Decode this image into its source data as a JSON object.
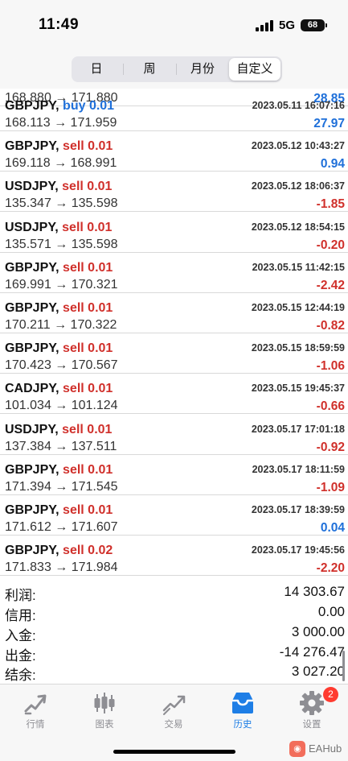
{
  "status_bar": {
    "time": "11:49",
    "network": "5G",
    "battery": "68"
  },
  "header": {
    "segments": [
      "日",
      "周",
      "月份",
      "自定义"
    ],
    "active_segment": "自定义"
  },
  "partial_row": {
    "prices": "168.880 → 171.880",
    "profit": "28.85"
  },
  "trades": [
    {
      "symbol": "GBPJPY,",
      "side": "buy 0.01",
      "side_type": "buy",
      "prices": "168.113 → 171.959",
      "time": "2023.05.11 16:07:16",
      "profit": "27.97",
      "profit_sign": "pos"
    },
    {
      "symbol": "GBPJPY,",
      "side": "sell 0.01",
      "side_type": "sell",
      "prices": "169.118 → 168.991",
      "time": "2023.05.12 10:43:27",
      "profit": "0.94",
      "profit_sign": "pos"
    },
    {
      "symbol": "USDJPY,",
      "side": "sell 0.01",
      "side_type": "sell",
      "prices": "135.347 → 135.598",
      "time": "2023.05.12 18:06:37",
      "profit": "-1.85",
      "profit_sign": "neg"
    },
    {
      "symbol": "USDJPY,",
      "side": "sell 0.01",
      "side_type": "sell",
      "prices": "135.571 → 135.598",
      "time": "2023.05.12 18:54:15",
      "profit": "-0.20",
      "profit_sign": "neg"
    },
    {
      "symbol": "GBPJPY,",
      "side": "sell 0.01",
      "side_type": "sell",
      "prices": "169.991 → 170.321",
      "time": "2023.05.15 11:42:15",
      "profit": "-2.42",
      "profit_sign": "neg"
    },
    {
      "symbol": "GBPJPY,",
      "side": "sell 0.01",
      "side_type": "sell",
      "prices": "170.211 → 170.322",
      "time": "2023.05.15 12:44:19",
      "profit": "-0.82",
      "profit_sign": "neg"
    },
    {
      "symbol": "GBPJPY,",
      "side": "sell 0.01",
      "side_type": "sell",
      "prices": "170.423 → 170.567",
      "time": "2023.05.15 18:59:59",
      "profit": "-1.06",
      "profit_sign": "neg"
    },
    {
      "symbol": "CADJPY,",
      "side": "sell 0.01",
      "side_type": "sell",
      "prices": "101.034 → 101.124",
      "time": "2023.05.15 19:45:37",
      "profit": "-0.66",
      "profit_sign": "neg"
    },
    {
      "symbol": "USDJPY,",
      "side": "sell 0.01",
      "side_type": "sell",
      "prices": "137.384 → 137.511",
      "time": "2023.05.17 17:01:18",
      "profit": "-0.92",
      "profit_sign": "neg"
    },
    {
      "symbol": "GBPJPY,",
      "side": "sell 0.01",
      "side_type": "sell",
      "prices": "171.394 → 171.545",
      "time": "2023.05.17 18:11:59",
      "profit": "-1.09",
      "profit_sign": "neg"
    },
    {
      "symbol": "GBPJPY,",
      "side": "sell 0.01",
      "side_type": "sell",
      "prices": "171.612 → 171.607",
      "time": "2023.05.17 18:39:59",
      "profit": "0.04",
      "profit_sign": "pos"
    },
    {
      "symbol": "GBPJPY,",
      "side": "sell 0.02",
      "side_type": "sell",
      "prices": "171.833 → 171.984",
      "time": "2023.05.17 19:45:56",
      "profit": "-2.20",
      "profit_sign": "neg"
    }
  ],
  "summary": [
    {
      "label": "利润:",
      "value": "14 303.67"
    },
    {
      "label": "信用:",
      "value": "0.00"
    },
    {
      "label": "入金:",
      "value": "3 000.00"
    },
    {
      "label": "出金:",
      "value": "-14 276.47"
    },
    {
      "label": "结余:",
      "value": "3 027.20"
    }
  ],
  "tabbar": {
    "tabs": [
      {
        "label": "行情",
        "icon": "quotes-icon"
      },
      {
        "label": "图表",
        "icon": "candlestick-chart-icon"
      },
      {
        "label": "交易",
        "icon": "trade-icon"
      },
      {
        "label": "历史",
        "icon": "history-inbox-icon"
      },
      {
        "label": "设置",
        "icon": "gear-icon"
      }
    ],
    "active_tab": "历史",
    "settings_badge": "2"
  },
  "watermark": {
    "text": "EAHub"
  },
  "colors": {
    "buy": "#1e6fd9",
    "sell": "#d0302b",
    "profit_positive": "#1e6fd9",
    "profit_negative": "#d0302b",
    "active_tab": "#1e7ee6",
    "badge": "#ff3b30"
  }
}
